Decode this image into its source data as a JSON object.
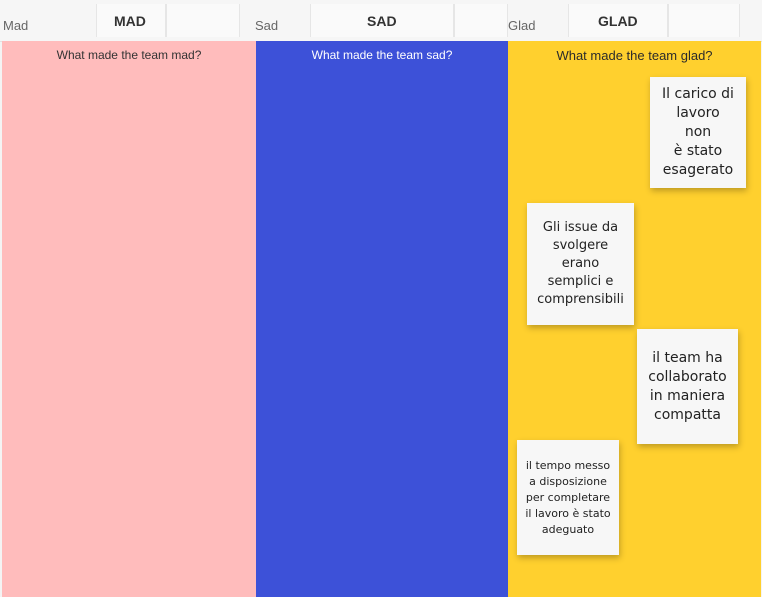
{
  "header": {
    "columns": [
      {
        "small_label": "Mad",
        "big_label": "MAD"
      },
      {
        "small_label": "Sad",
        "big_label": "SAD"
      },
      {
        "small_label": "Glad",
        "big_label": "GLAD"
      }
    ]
  },
  "columns": [
    {
      "id": "mad",
      "question": "What made the team mad?",
      "color": "#ffbcbc"
    },
    {
      "id": "sad",
      "question": "What made the team sad?",
      "color": "#3d51d8"
    },
    {
      "id": "glad",
      "question": "What made the team glad?",
      "color": "#ffd02e"
    }
  ],
  "notes": [
    {
      "column": "glad",
      "lines": [
        "Il carico di",
        "lavoro",
        "non",
        "è stato",
        "esagerato"
      ]
    },
    {
      "column": "glad",
      "lines": [
        "Gli issue da",
        "svolgere",
        "erano",
        "semplici e",
        "comprensibili"
      ]
    },
    {
      "column": "glad",
      "lines": [
        "il team ha",
        "collaborato",
        "in maniera",
        "compatta"
      ]
    },
    {
      "column": "glad",
      "lines": [
        "il tempo messo",
        "a disposizione",
        "per completare",
        "il lavoro è stato",
        "adeguato"
      ]
    }
  ]
}
